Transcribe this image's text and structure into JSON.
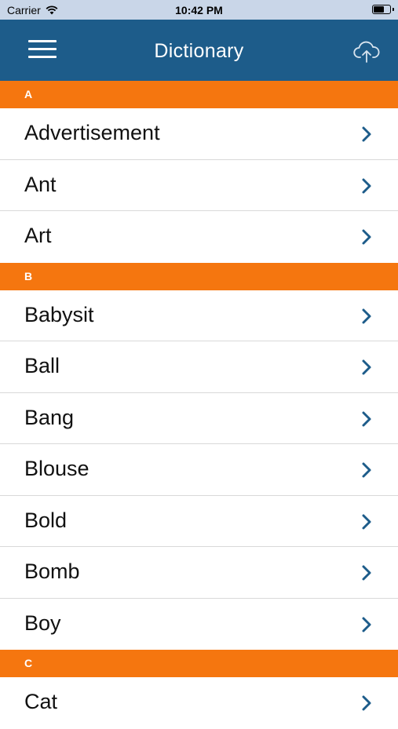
{
  "status_bar": {
    "carrier": "Carrier",
    "time": "10:42 PM"
  },
  "nav": {
    "title": "Dictionary",
    "menu_icon": "hamburger-icon",
    "upload_icon": "cloud-upload-icon"
  },
  "colors": {
    "nav_background": "#1d5c8a",
    "section_header": "#f5760f",
    "chevron": "#1d5c8a"
  },
  "sections": [
    {
      "letter": "A",
      "words": [
        "Advertisement",
        "Ant",
        "Art"
      ]
    },
    {
      "letter": "B",
      "words": [
        "Babysit",
        "Ball",
        "Bang",
        "Blouse",
        "Bold",
        "Bomb",
        "Boy"
      ]
    },
    {
      "letter": "C",
      "words": [
        "Cat"
      ]
    }
  ]
}
